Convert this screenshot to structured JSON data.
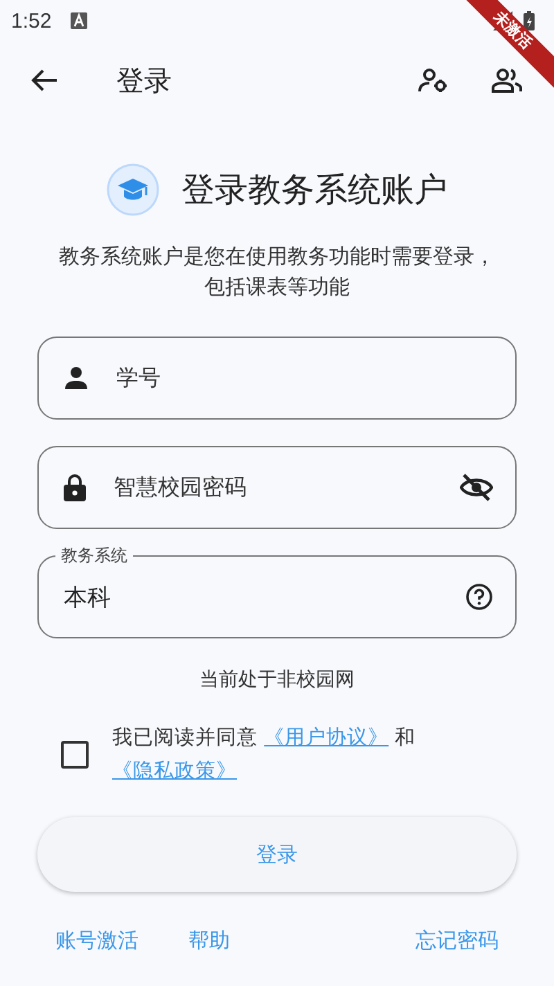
{
  "status_bar": {
    "time": "1:52"
  },
  "banner": {
    "text": "未激活"
  },
  "app_bar": {
    "title": "登录"
  },
  "header": {
    "title": "登录教务系统账户",
    "description": "教务系统账户是您在使用教务功能时需要登录，包括课表等功能"
  },
  "fields": [
    {
      "kind": "text",
      "placeholder": "学号"
    },
    {
      "kind": "password",
      "placeholder": "智慧校园密码",
      "obscured": true
    },
    {
      "kind": "select",
      "label": "教务系统",
      "value": "本科"
    }
  ],
  "network_status": "当前处于非校园网",
  "agreement": {
    "checked": false,
    "text": "我已阅读并同意",
    "link_1": "《用户协议》",
    "joiner": "和",
    "link_2": "《隐私政策》"
  },
  "login_button": "登录",
  "footer_links": [
    "账号激活",
    "帮助",
    "忘记密码"
  ]
}
